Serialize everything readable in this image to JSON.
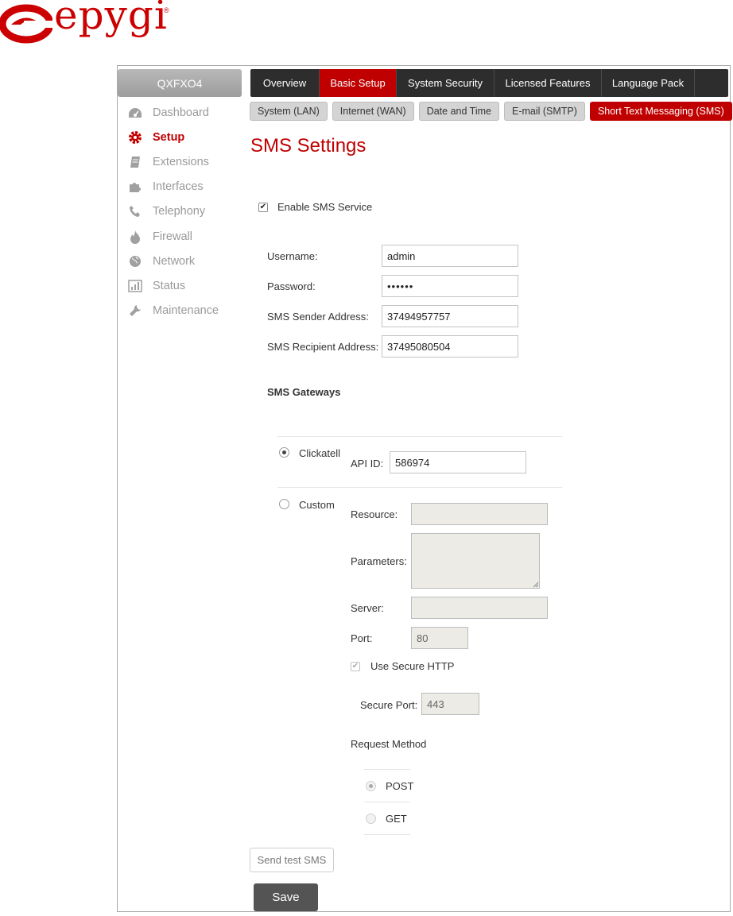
{
  "brand": {
    "logo_text": "epygi",
    "registered_mark": "®",
    "accent_color": "#c00000"
  },
  "sidebar": {
    "device_name": "QXFXO4",
    "items": [
      {
        "label": "Dashboard",
        "icon": "dashboard-icon"
      },
      {
        "label": "Setup",
        "icon": "gear-icon",
        "active": true
      },
      {
        "label": "Extensions",
        "icon": "book-icon"
      },
      {
        "label": "Interfaces",
        "icon": "puzzle-icon"
      },
      {
        "label": "Telephony",
        "icon": "phone-icon"
      },
      {
        "label": "Firewall",
        "icon": "flame-icon"
      },
      {
        "label": "Network",
        "icon": "globe-icon"
      },
      {
        "label": "Status",
        "icon": "bar-chart-icon"
      },
      {
        "label": "Maintenance",
        "icon": "wrench-icon"
      }
    ]
  },
  "tabs": [
    {
      "label": "Overview"
    },
    {
      "label": "Basic Setup",
      "active": true
    },
    {
      "label": "System Security"
    },
    {
      "label": "Licensed Features"
    },
    {
      "label": "Language Pack"
    }
  ],
  "subtabs": [
    {
      "label": "System (LAN)"
    },
    {
      "label": "Internet (WAN)"
    },
    {
      "label": "Date and Time"
    },
    {
      "label": "E-mail (SMTP)"
    },
    {
      "label": "Short Text Messaging (SMS)",
      "active": true
    }
  ],
  "page_title": "SMS Settings",
  "form": {
    "enable_sms_label": "Enable SMS Service",
    "enable_sms_checked": true,
    "username_label": "Username:",
    "username_value": "admin",
    "password_label": "Password:",
    "password_value": "••••••",
    "sender_label": "SMS Sender Address:",
    "sender_value": "37494957757",
    "recipient_label": "SMS Recipient Address:",
    "recipient_value": "37495080504",
    "gateways_heading": "SMS Gateways",
    "clickatell_label": "Clickatell",
    "clickatell_selected": true,
    "api_id_label": "API ID:",
    "api_id_value": "586974",
    "custom_label": "Custom",
    "resource_label": "Resource:",
    "resource_value": "",
    "parameters_label": "Parameters:",
    "parameters_value": "",
    "server_label": "Server:",
    "server_value": "",
    "port_label": "Port:",
    "port_value": "80",
    "secure_http_label": "Use Secure HTTP",
    "secure_http_checked": true,
    "secure_port_label": "Secure Port:",
    "secure_port_value": "443",
    "request_method_label": "Request Method",
    "post_label": "POST",
    "get_label": "GET"
  },
  "buttons": {
    "send_test_label": "Send test SMS",
    "save_label": "Save"
  }
}
